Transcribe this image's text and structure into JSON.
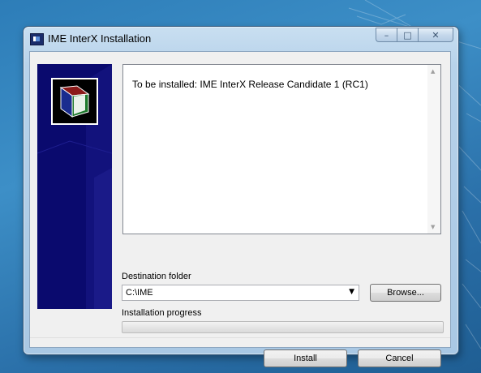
{
  "window": {
    "title": "IME InterX Installation",
    "controls": {
      "minimize": "–",
      "maximize": "□",
      "close": "✕"
    }
  },
  "details": {
    "text": "To be installed: IME InterX Release Candidate 1 (RC1)"
  },
  "destination": {
    "label": "Destination folder",
    "value": "C:\\IME",
    "browse_label": "Browse..."
  },
  "progress": {
    "label": "Installation progress",
    "fraction": 0
  },
  "footer": {
    "install_label": "Install",
    "cancel_label": "Cancel"
  },
  "colors": {
    "banner": "#0a0a6e",
    "logo_red": "#8b1a1a",
    "logo_green": "#1f7a2e",
    "logo_blue": "#1a2c8f"
  }
}
